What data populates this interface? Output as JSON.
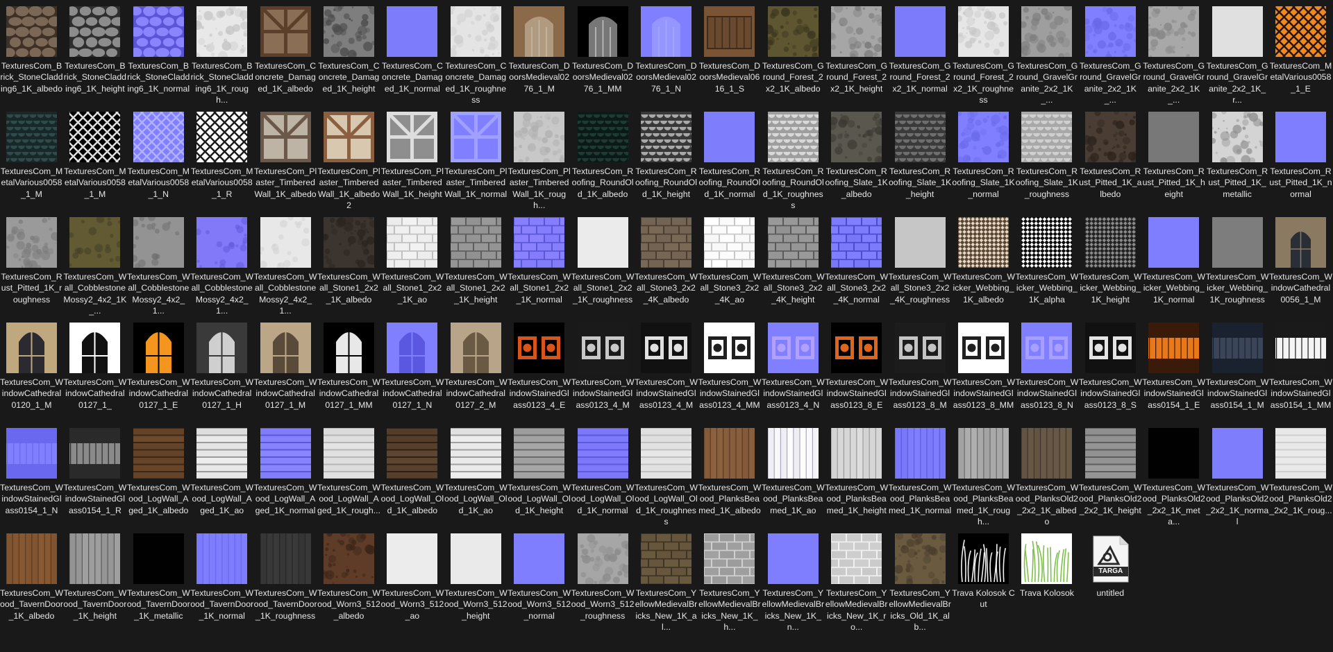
{
  "columns": 21,
  "colors": {
    "background": "#191919",
    "label": "#e6e6e6",
    "normal_map": "#7f7fff"
  },
  "files": [
    {
      "label": "TexturesCom_Brick_StoneCladding6_1K_albedo",
      "kind": "stone",
      "c1": "#7a6756",
      "c2": "#3f3026"
    },
    {
      "label": "TexturesCom_Brick_StoneCladding6_1K_height",
      "kind": "stone",
      "c1": "#8c8c8c",
      "c2": "#2e2e2e"
    },
    {
      "label": "TexturesCom_Brick_StoneCladding6_1K_normal",
      "kind": "stone",
      "c1": "#8b84ff",
      "c2": "#5a55d6"
    },
    {
      "label": "TexturesCom_Brick_StoneCladding6_1K_rough...",
      "kind": "noise",
      "c1": "#e8e8e8",
      "c2": "#c4c4c4"
    },
    {
      "label": "TexturesCom_Concrete_Damaged_1K_albedo",
      "kind": "timber",
      "c1": "#8a6e55",
      "c2": "#5c3f2b"
    },
    {
      "label": "TexturesCom_Concrete_Damaged_1K_height",
      "kind": "noise",
      "c1": "#7e7e7e",
      "c2": "#4a4a4a"
    },
    {
      "label": "TexturesCom_Concrete_Damaged_1K_normal",
      "kind": "flat",
      "c1": "#7f7fff",
      "c2": "#7676f2"
    },
    {
      "label": "TexturesCom_Concrete_Damaged_1K_roughness",
      "kind": "noise",
      "c1": "#e4e4e4",
      "c2": "#cfcfcf"
    },
    {
      "label": "TexturesCom_DoorsMedieval0276_1_M",
      "kind": "door",
      "c1": "#8b6a4a",
      "c2": "#cfc3ae"
    },
    {
      "label": "TexturesCom_DoorsMedieval0276_1_MM",
      "kind": "door",
      "c1": "#000000",
      "c2": "#d8d8d8"
    },
    {
      "label": "TexturesCom_DoorsMedieval0276_1_N",
      "kind": "door",
      "c1": "#7f7fff",
      "c2": "#aaaaff"
    },
    {
      "label": "TexturesCom_DoorsMedieval0616_1_S",
      "kind": "wood",
      "c1": "#7a5535",
      "c2": "#3f2b1b"
    },
    {
      "label": "TexturesCom_Ground_Forest_2x2_1K_albedo",
      "kind": "noise",
      "c1": "#5e5630",
      "c2": "#3a351e"
    },
    {
      "label": "TexturesCom_Ground_Forest_2x2_1K_height",
      "kind": "noise",
      "c1": "#a6a6a6",
      "c2": "#7c7c7c"
    },
    {
      "label": "TexturesCom_Ground_Forest_2x2_1K_normal",
      "kind": "flat",
      "c1": "#7f7fff",
      "c2": "#7070f0"
    },
    {
      "label": "TexturesCom_Ground_Forest_2x2_1K_roughness",
      "kind": "noise",
      "c1": "#e6e6e6",
      "c2": "#c8c8c8"
    },
    {
      "label": "TexturesCom_Ground_GravelGranite_2x2_1K_...",
      "kind": "noise",
      "c1": "#9e9e9e",
      "c2": "#7e7e7e"
    },
    {
      "label": "TexturesCom_Ground_GravelGranite_2x2_1K_...",
      "kind": "noise",
      "c1": "#7f7fff",
      "c2": "#6868e8"
    },
    {
      "label": "TexturesCom_Ground_GravelGranite_2x2_1K_...",
      "kind": "noise",
      "c1": "#a8a8a8",
      "c2": "#868686"
    },
    {
      "label": "TexturesCom_Ground_GravelGranite_2x2_1K_r...",
      "kind": "flat",
      "c1": "#e2e2e2",
      "c2": "#dcdcdc"
    },
    {
      "label": "TexturesCom_MetalVarious0058_1_E",
      "kind": "lattice",
      "c1": "#f08a1e",
      "c2": "#2a1404"
    },
    {
      "label": "TexturesCom_MetalVarious0058_1_M",
      "kind": "scales",
      "c1": "#2e4a4a",
      "c2": "#182828"
    },
    {
      "label": "TexturesCom_MetalVarious0058_1_M",
      "kind": "lattice",
      "c1": "#000000",
      "c2": "#e0e0e0"
    },
    {
      "label": "TexturesCom_MetalVarious0058_1_N",
      "kind": "lattice",
      "c1": "#7f7fff",
      "c2": "#b2b2ff"
    },
    {
      "label": "TexturesCom_MetalVarious0058_1_R",
      "kind": "lattice",
      "c1": "#ffffff",
      "c2": "#1a1a1a"
    },
    {
      "label": "TexturesCom_Plaster_TimberedWall_1K_albedo",
      "kind": "timber",
      "c1": "#bdb4a6",
      "c2": "#6b5848"
    },
    {
      "label": "TexturesCom_Plaster_TimberedWall_1K_albedo2",
      "kind": "timber",
      "c1": "#d8c8b0",
      "c2": "#8a6040"
    },
    {
      "label": "TexturesCom_Plaster_TimberedWall_1K_height",
      "kind": "timber",
      "c1": "#8e8e8e",
      "c2": "#dedede"
    },
    {
      "label": "TexturesCom_Plaster_TimberedWall_1K_normal",
      "kind": "timber",
      "c1": "#7f7fff",
      "c2": "#a0a0ff"
    },
    {
      "label": "TexturesCom_Plaster_TimberedWall_1K_rough...",
      "kind": "noise",
      "c1": "#c8c8c8",
      "c2": "#b0b0b0"
    },
    {
      "label": "TexturesCom_Roofing_RoundOld_1K_albedo",
      "kind": "scales",
      "c1": "#1f3a33",
      "c2": "#0b1a16"
    },
    {
      "label": "TexturesCom_Roofing_RoundOld_1K_height",
      "kind": "scales",
      "c1": "#a8a8a8",
      "c2": "#383838"
    },
    {
      "label": "TexturesCom_Roofing_RoundOld_1K_normal",
      "kind": "flat",
      "c1": "#7f7fff",
      "c2": "#7a7af8"
    },
    {
      "label": "TexturesCom_Roofing_RoundOld_1K_roughness",
      "kind": "scales",
      "c1": "#d8d8d8",
      "c2": "#9e9e9e"
    },
    {
      "label": "TexturesCom_Roofing_Slate_1K_albedo",
      "kind": "noise",
      "c1": "#5a584e",
      "c2": "#3c3a34"
    },
    {
      "label": "TexturesCom_Roofing_Slate_1K_height",
      "kind": "scales",
      "c1": "#6e6e6e",
      "c2": "#3a3a3a"
    },
    {
      "label": "TexturesCom_Roofing_Slate_1K_normal",
      "kind": "noise",
      "c1": "#7f7fff",
      "c2": "#6a6aec"
    },
    {
      "label": "TexturesCom_Roofing_Slate_1K_roughness",
      "kind": "scales",
      "c1": "#cfcfcf",
      "c2": "#a8a8a8"
    },
    {
      "label": "TexturesCom_Rust_Pitted_1K_albedo",
      "kind": "noise",
      "c1": "#4a3d33",
      "c2": "#2b221c"
    },
    {
      "label": "TexturesCom_Rust_Pitted_1K_height",
      "kind": "flat",
      "c1": "#7a7a7a",
      "c2": "#727272"
    },
    {
      "label": "TexturesCom_Rust_Pitted_1K_metallic",
      "kind": "noise",
      "c1": "#d4d4d4",
      "c2": "#8e8e8e"
    },
    {
      "label": "TexturesCom_Rust_Pitted_1K_normal",
      "kind": "flat",
      "c1": "#7f7fff",
      "c2": "#7c7cfc"
    },
    {
      "label": "TexturesCom_Rust_Pitted_1K_roughness",
      "kind": "noise",
      "c1": "#9a9a9a",
      "c2": "#7c7c7c"
    },
    {
      "label": "TexturesCom_Wall_CobblestoneMossy2_4x2_1K_...",
      "kind": "band",
      "c1": "#6a6338",
      "c2": "#3f3b22"
    },
    {
      "label": "TexturesCom_Wall_CobblestoneMossy2_4x2_1...",
      "kind": "band",
      "c1": "#9e9e9e",
      "c2": "#6c6c6c"
    },
    {
      "label": "TexturesCom_Wall_CobblestoneMossy2_4x2_1...",
      "kind": "band",
      "c1": "#8a82ff",
      "c2": "#5e58da"
    },
    {
      "label": "TexturesCom_Wall_CobblestoneMossy2_4x2_1...",
      "kind": "band",
      "c1": "#eeeeee",
      "c2": "#cfcfcf"
    },
    {
      "label": "TexturesCom_Wall_Stone1_2x2_1K_albedo",
      "kind": "noise",
      "c1": "#3c342e",
      "c2": "#2a2420"
    },
    {
      "label": "TexturesCom_Wall_Stone1_2x2_1K_ao",
      "kind": "bricks",
      "c1": "#f2f2f2",
      "c2": "#c0c0c0"
    },
    {
      "label": "TexturesCom_Wall_Stone1_2x2_1K_height",
      "kind": "bricks",
      "c1": "#9a9a9a",
      "c2": "#5e5e5e"
    },
    {
      "label": "TexturesCom_Wall_Stone1_2x2_1K_normal",
      "kind": "bricks",
      "c1": "#8a82ff",
      "c2": "#5a56d8"
    },
    {
      "label": "TexturesCom_Wall_Stone1_2x2_1K_roughness",
      "kind": "flat",
      "c1": "#eeeeee",
      "c2": "#e4e4e4"
    },
    {
      "label": "TexturesCom_Wall_Stone3_2x2_4K_albedo",
      "kind": "bricks",
      "c1": "#7a6a58",
      "c2": "#4a3e32"
    },
    {
      "label": "TexturesCom_Wall_Stone3_2x2_4K_ao",
      "kind": "bricks",
      "c1": "#ffffff",
      "c2": "#c8c8c8"
    },
    {
      "label": "TexturesCom_Wall_Stone3_2x2_4K_height",
      "kind": "bricks",
      "c1": "#9c9c9c",
      "c2": "#5a5a5a"
    },
    {
      "label": "TexturesCom_Wall_Stone3_2x2_4K_normal",
      "kind": "bricks",
      "c1": "#7f7fff",
      "c2": "#4e4ad0"
    },
    {
      "label": "TexturesCom_Wall_Stone3_2x2_4K_roughness",
      "kind": "flat",
      "c1": "#c8c8c8",
      "c2": "#c0c0c0"
    },
    {
      "label": "TexturesCom_Wicker_Webbing_1K_albedo",
      "kind": "mesh",
      "c1": "#e4d8c4",
      "c2": "#5a4632"
    },
    {
      "label": "TexturesCom_Wicker_Webbing_1K_alpha",
      "kind": "mesh",
      "c1": "#ffffff",
      "c2": "#0c0c0c"
    },
    {
      "label": "TexturesCom_Wicker_Webbing_1K_height",
      "kind": "mesh",
      "c1": "#8a8a8a",
      "c2": "#222222"
    },
    {
      "label": "TexturesCom_Wicker_Webbing_1K_normal",
      "kind": "flat",
      "c1": "#7f7fff",
      "c2": "#7c7cfc"
    },
    {
      "label": "TexturesCom_Wicker_Webbing_1K_roughness",
      "kind": "flat",
      "c1": "#7e7e7e",
      "c2": "#7a7a7a"
    },
    {
      "label": "TexturesCom_WindowCathedral0056_1_M",
      "kind": "cathedral",
      "c1": "#8a7a62",
      "c2": "#2a2e36"
    },
    {
      "label": "TexturesCom_WindowCathedral0120_1_M",
      "kind": "arch",
      "c1": "#c0a87e",
      "c2": "#2a2a30"
    },
    {
      "label": "TexturesCom_WindowCathedral0127_1_",
      "kind": "arch",
      "c1": "#ffffff",
      "c2": "#111111"
    },
    {
      "label": "TexturesCom_WindowCathedral0127_1_E",
      "kind": "arch",
      "c1": "#000000",
      "c2": "#f4961e"
    },
    {
      "label": "TexturesCom_WindowCathedral0127_1_H",
      "kind": "arch",
      "c1": "#3a3a3a",
      "c2": "#cfcfcf"
    },
    {
      "label": "TexturesCom_WindowCathedral0127_1_M",
      "kind": "arch",
      "c1": "#bca688",
      "c2": "#5a4a3a"
    },
    {
      "label": "TexturesCom_WindowCathedral0127_1_MM",
      "kind": "arch",
      "c1": "#000000",
      "c2": "#e8e8e8"
    },
    {
      "label": "TexturesCom_WindowCathedral0127_1_N",
      "kind": "arch",
      "c1": "#7f7fff",
      "c2": "#5a58e0"
    },
    {
      "label": "TexturesCom_WindowCathedral0127_2_M",
      "kind": "arch",
      "c1": "#b8a488",
      "c2": "#6a5a44"
    },
    {
      "label": "TexturesCom_WindowStainedGlass0123_4_E",
      "kind": "stained",
      "c1": "#000000",
      "c2": "#d8541a"
    },
    {
      "label": "TexturesCom_WindowStainedGlass0123_4_M",
      "kind": "stained",
      "c1": "#1a1a1a",
      "c2": "#c8c8c8"
    },
    {
      "label": "TexturesCom_WindowStainedGlass0123_4_M",
      "kind": "stained",
      "c1": "#111111",
      "c2": "#e0e0e0"
    },
    {
      "label": "TexturesCom_WindowStainedGlass0123_4_MM",
      "kind": "stained",
      "c1": "#ffffff",
      "c2": "#202020"
    },
    {
      "label": "TexturesCom_WindowStainedGlass0123_4_N",
      "kind": "stained",
      "c1": "#7f7fff",
      "c2": "#b0a0ff"
    },
    {
      "label": "TexturesCom_WindowStainedGlass0123_8_E",
      "kind": "stained",
      "c1": "#000000",
      "c2": "#e0641c"
    },
    {
      "label": "TexturesCom_WindowStainedGlass0123_8_M",
      "kind": "stained",
      "c1": "#1c1c1c",
      "c2": "#c4c4c4"
    },
    {
      "label": "TexturesCom_WindowStainedGlass0123_8_MM",
      "kind": "stained",
      "c1": "#ffffff",
      "c2": "#202020"
    },
    {
      "label": "TexturesCom_WindowStainedGlass0123_8_N",
      "kind": "stained",
      "c1": "#7f7fff",
      "c2": "#a8a0ff"
    },
    {
      "label": "TexturesCom_WindowStainedGlass0123_8_S",
      "kind": "stained",
      "c1": "#111111",
      "c2": "#e4e4e4"
    },
    {
      "label": "TexturesCom_WindowStainedGlass0154_1_E",
      "kind": "panes",
      "c1": "#e87818",
      "c2": "#3a1a08"
    },
    {
      "label": "TexturesCom_WindowStainedGlass0154_1_M",
      "kind": "panes",
      "c1": "#3a4658",
      "c2": "#1a2230"
    },
    {
      "label": "TexturesCom_WindowStainedGlass0154_1_MM",
      "kind": "panes",
      "c1": "#f4f4f4",
      "c2": "#1a1a1a"
    },
    {
      "label": "TexturesCom_WindowStainedGlass0154_1_N",
      "kind": "panes",
      "c1": "#7f7fff",
      "c2": "#6a68ee"
    },
    {
      "label": "TexturesCom_WindowStainedGlass0154_1_R",
      "kind": "panes",
      "c1": "#8a8a8a",
      "c2": "#2a2a2a"
    },
    {
      "label": "TexturesCom_Wood_LogWall_Aged_1K_albedo",
      "kind": "logs",
      "c1": "#6e4a2c",
      "c2": "#3a2616"
    },
    {
      "label": "TexturesCom_Wood_LogWall_Aged_1K_ao",
      "kind": "logs",
      "c1": "#eeeeee",
      "c2": "#9a9a9a"
    },
    {
      "label": "TexturesCom_Wood_LogWall_Aged_1K_normal",
      "kind": "logs",
      "c1": "#8a86ff",
      "c2": "#5a56dc"
    },
    {
      "label": "TexturesCom_Wood_LogWall_Aged_1K_rough...",
      "kind": "logs",
      "c1": "#e4e4e4",
      "c2": "#b6b6b6"
    },
    {
      "label": "TexturesCom_Wood_LogWall_Old_1K_albedo",
      "kind": "logs",
      "c1": "#5e4530",
      "c2": "#2e2014"
    },
    {
      "label": "TexturesCom_Wood_LogWall_Old_1K_ao",
      "kind": "logs",
      "c1": "#f0f0f0",
      "c2": "#a0a0a0"
    },
    {
      "label": "TexturesCom_Wood_LogWall_Old_1K_height",
      "kind": "logs",
      "c1": "#a8a8a8",
      "c2": "#6a6a6a"
    },
    {
      "label": "TexturesCom_Wood_LogWall_Old_1K_normal",
      "kind": "logs",
      "c1": "#8480ff",
      "c2": "#5e5ae0"
    },
    {
      "label": "TexturesCom_Wood_LogWall_Old_1K_roughness",
      "kind": "logs",
      "c1": "#e6e6e6",
      "c2": "#c0c0c0"
    },
    {
      "label": "TexturesCom_Wood_PlanksBeamed_1K_albedo",
      "kind": "planks",
      "c1": "#8e6240",
      "c2": "#5a3a22"
    },
    {
      "label": "TexturesCom_Wood_PlanksBeamed_1K_ao",
      "kind": "planks",
      "c1": "#ffffff",
      "c2": "#a8a8c0"
    },
    {
      "label": "TexturesCom_Wood_PlanksBeamed_1K_height",
      "kind": "planks",
      "c1": "#e0e0e0",
      "c2": "#9a9a9a"
    },
    {
      "label": "TexturesCom_Wood_PlanksBeamed_1K_normal",
      "kind": "planks",
      "c1": "#7f7fff",
      "c2": "#5e5ce2"
    },
    {
      "label": "TexturesCom_Wood_PlanksBeamed_1K_rough...",
      "kind": "planks",
      "c1": "#b0b0b0",
      "c2": "#6a6a6a"
    },
    {
      "label": "TexturesCom_Wood_PlanksOld2_2x2_1K_albedo",
      "kind": "planks",
      "c1": "#6a5a48",
      "c2": "#40342a"
    },
    {
      "label": "TexturesCom_Wood_PlanksOld2_2x2_1K_height",
      "kind": "logs",
      "c1": "#9a9a9a",
      "c2": "#5e5e5e"
    },
    {
      "label": "TexturesCom_Wood_PlanksOld2_2x2_1K_meta...",
      "kind": "flat",
      "c1": "#000000",
      "c2": "#020202"
    },
    {
      "label": "TexturesCom_Wood_PlanksOld2_2x2_1K_normal",
      "kind": "flat",
      "c1": "#7f7fff",
      "c2": "#7a7af8"
    },
    {
      "label": "TexturesCom_Wood_PlanksOld2_2x2_1K_roug...",
      "kind": "logs",
      "c1": "#ebebeb",
      "c2": "#cfcfcf"
    },
    {
      "label": "TexturesCom_Wood_TavernDoor_1K_albedo",
      "kind": "planks",
      "c1": "#8a5a34",
      "c2": "#5a3a20"
    },
    {
      "label": "TexturesCom_Wood_TavernDoor_1K_height",
      "kind": "planks",
      "c1": "#a0a0a0",
      "c2": "#5c5c5c"
    },
    {
      "label": "TexturesCom_Wood_TavernDoor_1K_metallic",
      "kind": "flat",
      "c1": "#000000",
      "c2": "#050505"
    },
    {
      "label": "TexturesCom_Wood_TavernDoor_1K_normal",
      "kind": "planks",
      "c1": "#7f7fff",
      "c2": "#6a68f0"
    },
    {
      "label": "TexturesCom_Wood_TavernDoor_1K_roughness",
      "kind": "planks",
      "c1": "#3a3a3a",
      "c2": "#262626"
    },
    {
      "label": "TexturesCom_Wood_Worn3_512_albedo",
      "kind": "noise",
      "c1": "#5e3c28",
      "c2": "#3a2418"
    },
    {
      "label": "TexturesCom_Wood_Worn3_512_ao",
      "kind": "flat",
      "c1": "#eeeeee",
      "c2": "#e6e6e6"
    },
    {
      "label": "TexturesCom_Wood_Worn3_512_height",
      "kind": "flat",
      "c1": "#ededed",
      "c2": "#e2e2e2"
    },
    {
      "label": "TexturesCom_Wood_Worn3_512_normal",
      "kind": "flat",
      "c1": "#7f7fff",
      "c2": "#7c7cfc"
    },
    {
      "label": "TexturesCom_Wood_Worn3_512_roughness",
      "kind": "noise",
      "c1": "#a6a6a6",
      "c2": "#8a8a8a"
    },
    {
      "label": "TexturesCom_YellowMedievalBricks_New_1K_al...",
      "kind": "bricks",
      "c1": "#6a5a40",
      "c2": "#3e3424"
    },
    {
      "label": "TexturesCom_YellowMedievalBricks_New_1K_h...",
      "kind": "bricks",
      "c1": "#9a9a9a",
      "c2": "#d0d0d0"
    },
    {
      "label": "TexturesCom_YellowMedievalBricks_New_1K_n...",
      "kind": "flat",
      "c1": "#7f7fff",
      "c2": "#7a7afa"
    },
    {
      "label": "TexturesCom_YellowMedievalBricks_New_1K_ro...",
      "kind": "bricks",
      "c1": "#c8c8c8",
      "c2": "#f0f0f0"
    },
    {
      "label": "TexturesCom_YellowMedievalBricks_Old_1K_alb...",
      "kind": "noise",
      "c1": "#6a5a40",
      "c2": "#4a3e2c"
    },
    {
      "label": "Trava Kolosok Cut",
      "kind": "grass",
      "c1": "#000000",
      "c2": "#f2f2f2"
    },
    {
      "label": "Trava Kolosok",
      "kind": "grass",
      "c1": "#ffffff",
      "c2": "#7cc04a"
    },
    {
      "label": "untitled",
      "kind": "targa",
      "c1": "#f4f4f4",
      "c2": "#2a2a2a",
      "badge": "TARGA"
    }
  ]
}
